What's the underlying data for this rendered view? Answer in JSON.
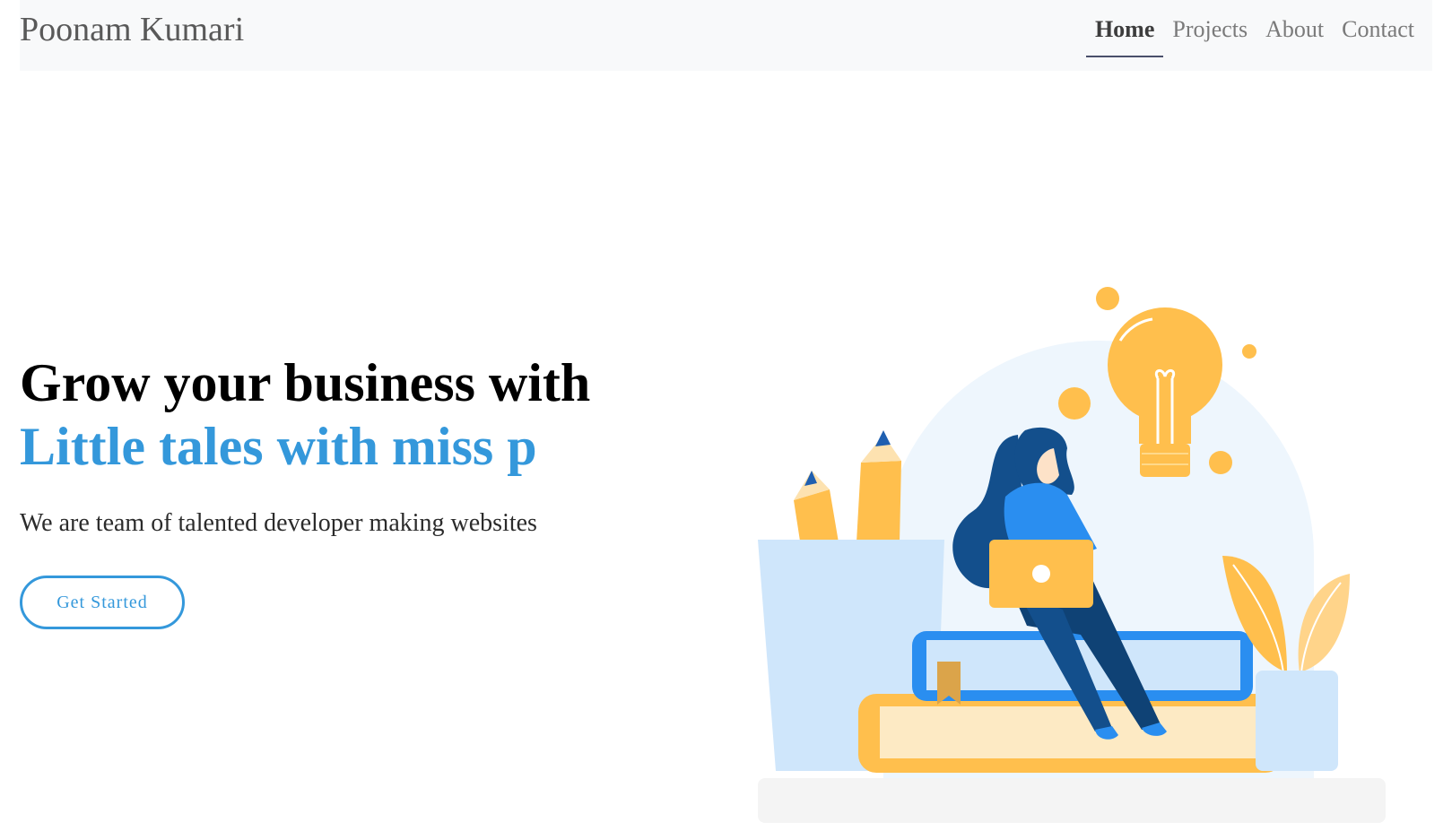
{
  "navbar": {
    "brand": "Poonam Kumari",
    "links": [
      {
        "label": "Home",
        "active": true
      },
      {
        "label": "Projects",
        "active": false
      },
      {
        "label": "About",
        "active": false
      },
      {
        "label": "Contact",
        "active": false
      }
    ]
  },
  "hero": {
    "headline_line1": "Grow your business with",
    "headline_line2": "Little tales with miss p",
    "tagline": "We are team of talented developer making websites",
    "cta_label": "Get Started"
  },
  "colors": {
    "accent": "#3498db",
    "navbar_bg": "#f8f9fa",
    "illustration_yellow": "#ffbf4d",
    "illustration_blue": "#2a8ef0",
    "illustration_light_blue": "#cfe6fb"
  },
  "illustration": {
    "icon": "woman-with-laptop-on-books-illustration"
  }
}
